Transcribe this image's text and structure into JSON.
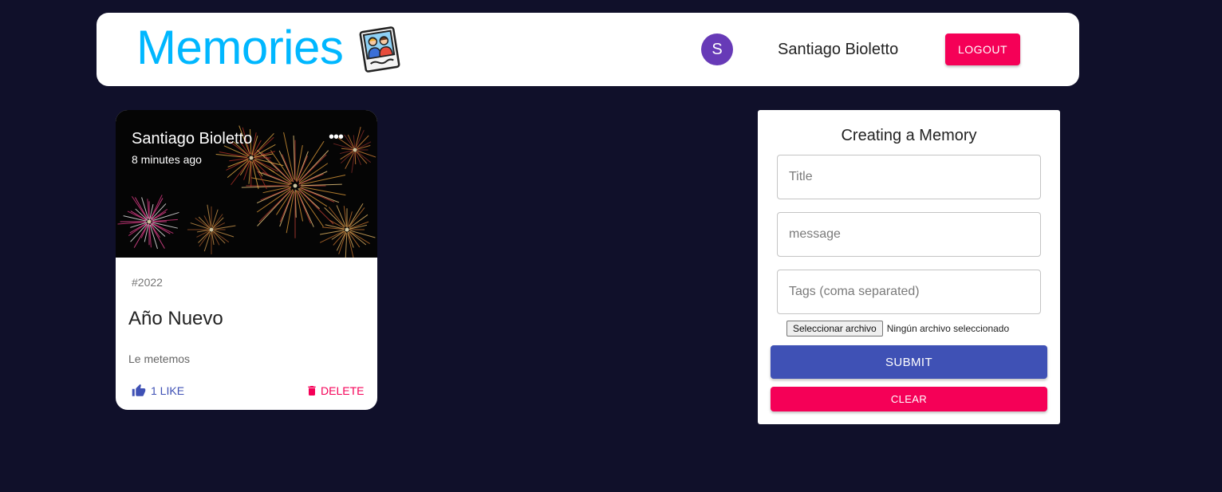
{
  "colors": {
    "background": "#10102a",
    "brand": "#00b7ff",
    "primary": "#3f51b5",
    "secondary": "#f50057",
    "avatar": "#673ab7"
  },
  "appbar": {
    "brand_title": "Memories",
    "brand_icon": "photo-memories-icon",
    "avatar_letter": "S",
    "user_name": "Santiago Bioletto",
    "logout_label": "LOGOUT"
  },
  "post": {
    "author": "Santiago Bioletto",
    "time_ago": "8 minutes ago",
    "more_icon": "more-horizontal-icon",
    "more_glyph": "•••",
    "tags": "#2022",
    "title": "Año Nuevo",
    "message": "Le metemos",
    "like_label": "1 LIKE",
    "like_icon": "thumb-up-icon",
    "delete_label": "DELETE",
    "delete_icon": "trash-icon",
    "image": "fireworks-image"
  },
  "form": {
    "heading": "Creating a Memory",
    "title_placeholder": "Title",
    "message_placeholder": "message",
    "tags_placeholder": "Tags (coma separated)",
    "file_button_label": "Seleccionar archivo",
    "file_status": "Ningún archivo seleccionado",
    "submit_label": "SUBMIT",
    "clear_label": "CLEAR"
  }
}
